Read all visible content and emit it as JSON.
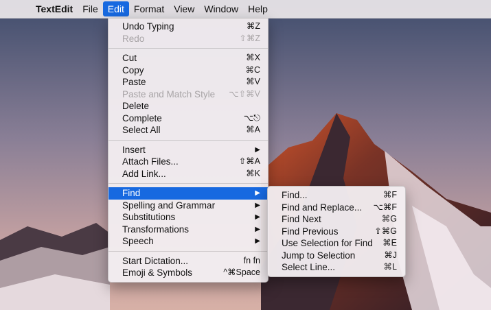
{
  "menubar": {
    "app_name": "TextEdit",
    "items": [
      "File",
      "Edit",
      "Format",
      "View",
      "Window",
      "Help"
    ]
  },
  "edit_menu": {
    "undo_typing": {
      "label": "Undo Typing",
      "shortcut": "⌘Z"
    },
    "redo": {
      "label": "Redo",
      "shortcut": "⇧⌘Z"
    },
    "cut": {
      "label": "Cut",
      "shortcut": "⌘X"
    },
    "copy": {
      "label": "Copy",
      "shortcut": "⌘C"
    },
    "paste": {
      "label": "Paste",
      "shortcut": "⌘V"
    },
    "paste_match": {
      "label": "Paste and Match Style",
      "shortcut": "⌥⇧⌘V"
    },
    "delete": {
      "label": "Delete"
    },
    "complete": {
      "label": "Complete",
      "shortcut": "⌥⎋"
    },
    "select_all": {
      "label": "Select All",
      "shortcut": "⌘A"
    },
    "insert": {
      "label": "Insert",
      "shortcut": "▶"
    },
    "attach_files": {
      "label": "Attach Files...",
      "shortcut": "⇧⌘A"
    },
    "add_link": {
      "label": "Add Link...",
      "shortcut": "⌘K"
    },
    "find": {
      "label": "Find",
      "shortcut": "▶"
    },
    "spelling": {
      "label": "Spelling and Grammar",
      "shortcut": "▶"
    },
    "substitutions": {
      "label": "Substitutions",
      "shortcut": "▶"
    },
    "transformations": {
      "label": "Transformations",
      "shortcut": "▶"
    },
    "speech": {
      "label": "Speech",
      "shortcut": "▶"
    },
    "start_dictation": {
      "label": "Start Dictation...",
      "shortcut": "fn fn"
    },
    "emoji": {
      "label": "Emoji & Symbols",
      "shortcut": "^⌘Space"
    }
  },
  "find_menu": {
    "find": {
      "label": "Find...",
      "shortcut": "⌘F"
    },
    "find_replace": {
      "label": "Find and Replace...",
      "shortcut": "⌥⌘F"
    },
    "find_next": {
      "label": "Find Next",
      "shortcut": "⌘G"
    },
    "find_previous": {
      "label": "Find Previous",
      "shortcut": "⇧⌘G"
    },
    "use_selection": {
      "label": "Use Selection for Find",
      "shortcut": "⌘E"
    },
    "jump_selection": {
      "label": "Jump to Selection",
      "shortcut": "⌘J"
    },
    "select_line": {
      "label": "Select Line...",
      "shortcut": "⌘L"
    }
  },
  "colors": {
    "accent": "#1769e0",
    "sky_top": "#44506e",
    "sky_bottom": "#c9a6a2",
    "mountain": "#3a2730"
  }
}
